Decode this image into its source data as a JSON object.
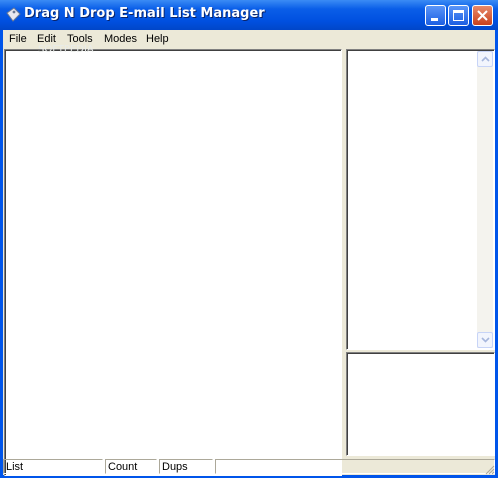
{
  "window": {
    "title": "Drag N Drop E-mail List Manager"
  },
  "watermark": "SOFTPEDIA",
  "menu": {
    "items": [
      "File",
      "Edit",
      "Tools",
      "Modes",
      "Help"
    ]
  },
  "status": {
    "panels": [
      "List",
      "Count",
      "Dups",
      ""
    ]
  },
  "colors": {
    "titlebar": "#0055ea",
    "face": "#ece9d8",
    "pane": "#ffffff"
  },
  "icons": {
    "app": "envelope-tag-icon"
  }
}
